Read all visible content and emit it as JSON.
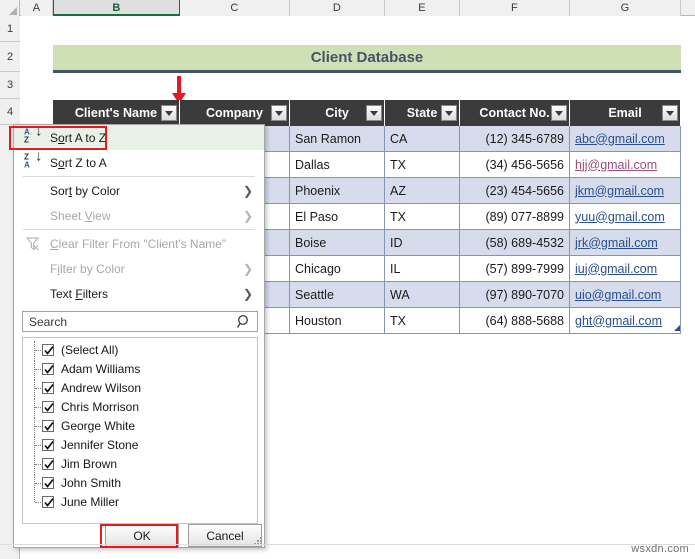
{
  "spreadsheet": {
    "column_headers": [
      "A",
      "B",
      "C",
      "D",
      "E",
      "F",
      "G"
    ],
    "selected_column": "B",
    "row_headers": [
      "1",
      "2",
      "3",
      "4"
    ],
    "title_banner": "Client Database"
  },
  "table": {
    "headers": [
      "Client's Name",
      "Company",
      "City",
      "State",
      "Contact No.",
      "Email"
    ],
    "rows": [
      {
        "city": "San Ramon",
        "state": "CA",
        "contact": "(12) 345-6789",
        "email": "abc@gmail.com",
        "email_visited": false
      },
      {
        "city": "Dallas",
        "state": "TX",
        "contact": "(34) 456-5656",
        "email": "hjj@gmail.com",
        "email_visited": true
      },
      {
        "city": "Phoenix",
        "state": "AZ",
        "contact": "(23) 454-5656",
        "email": "jkm@gmail.com",
        "email_visited": false
      },
      {
        "city": "El Paso",
        "state": "TX",
        "contact": "(89) 077-8899",
        "email": "yuu@gmail.com",
        "email_visited": false
      },
      {
        "city": "Boise",
        "state": "ID",
        "contact": "(58) 689-4532",
        "email": "jrk@gmail.com",
        "email_visited": false
      },
      {
        "city": "Chicago",
        "state": "IL",
        "contact": "(57) 899-7999",
        "email": "iuj@gmail.com",
        "email_visited": false
      },
      {
        "city": "Seattle",
        "state": "WA",
        "contact": "(97) 890-7070",
        "email": "uio@gmail.com",
        "email_visited": false
      },
      {
        "city": "Houston",
        "state": "TX",
        "contact": "(64) 888-5688",
        "email": "ght@gmail.com",
        "email_visited": false
      }
    ]
  },
  "filter_dropdown": {
    "menu_items": [
      {
        "label": "Sort A to Z",
        "icon": "sort-az-icon",
        "disabled": false,
        "highlighted": true,
        "submenu": false
      },
      {
        "label": "Sort Z to A",
        "icon": "sort-za-icon",
        "disabled": false,
        "highlighted": false,
        "submenu": false
      },
      {
        "label": "Sort by Color",
        "icon": "",
        "disabled": false,
        "highlighted": false,
        "submenu": true
      },
      {
        "label": "Sheet View",
        "icon": "",
        "disabled": true,
        "highlighted": false,
        "submenu": true
      },
      {
        "label": "Clear Filter From \"Client's Name\"",
        "icon": "clear-filter-icon",
        "disabled": true,
        "highlighted": false,
        "submenu": false
      },
      {
        "label": "Filter by Color",
        "icon": "",
        "disabled": true,
        "highlighted": false,
        "submenu": true
      },
      {
        "label": "Text Filters",
        "icon": "",
        "disabled": false,
        "highlighted": false,
        "submenu": true
      }
    ],
    "search": {
      "value": "",
      "placeholder": "Search"
    },
    "checklist": [
      {
        "label": "(Select All)",
        "checked": true
      },
      {
        "label": "Adam Williams",
        "checked": true
      },
      {
        "label": "Andrew Wilson",
        "checked": true
      },
      {
        "label": "Chris Morrison",
        "checked": true
      },
      {
        "label": "George White",
        "checked": true
      },
      {
        "label": "Jennifer Stone",
        "checked": true
      },
      {
        "label": "Jim Brown",
        "checked": true
      },
      {
        "label": "John Smith",
        "checked": true
      },
      {
        "label": "June Miller",
        "checked": true
      }
    ],
    "ok_label": "OK",
    "cancel_label": "Cancel"
  },
  "annotations": {
    "arrow": "red-down-arrow",
    "highlight_boxes": [
      "sort-a-to-z",
      "ok-button"
    ]
  },
  "watermark": "wsxdn.com",
  "colors": {
    "banner_fill": "#cfe0b4",
    "banner_text": "#44546a",
    "table_header_fill": "#3b3b3b",
    "row_alt_fill": "#d6dcec",
    "grid_border": "#8496b0",
    "link": "#2a4f8f",
    "link_visited": "#9a4f77",
    "annotation_red": "#e8191b",
    "menu_highlight": "#e8f1e8",
    "selected_col_accent": "#1b6b3f"
  }
}
